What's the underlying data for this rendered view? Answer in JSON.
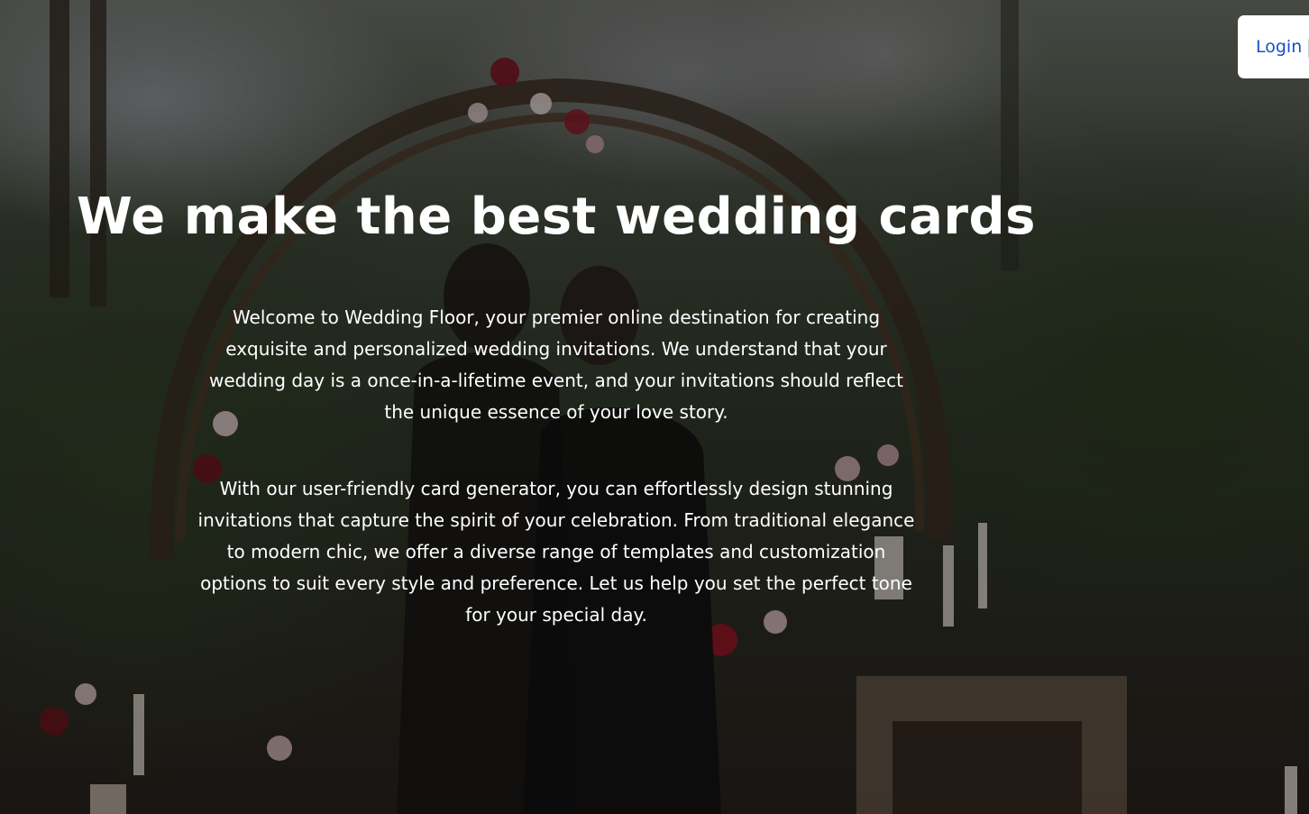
{
  "nav": {
    "login_label": "Login",
    "separator": "|"
  },
  "hero": {
    "title": "We make the best wedding cards",
    "paragraph_1": "Welcome to Wedding Floor, your premier online destination for creating exquisite and personalized wedding invitations. We understand that your wedding day is a once-in-a-lifetime event, and your invitations should reflect the unique essence of your love story.",
    "paragraph_2": "With our user-friendly card generator, you can effortlessly design stunning invitations that capture the spirit of your celebration. From traditional elegance to modern chic, we offer a diverse range of templates and customization options to suit every style and preference. Let us help you set the perfect tone for your special day."
  },
  "colors": {
    "link": "#1452c8",
    "text": "#ffffff",
    "login_background": "#ffffff"
  }
}
